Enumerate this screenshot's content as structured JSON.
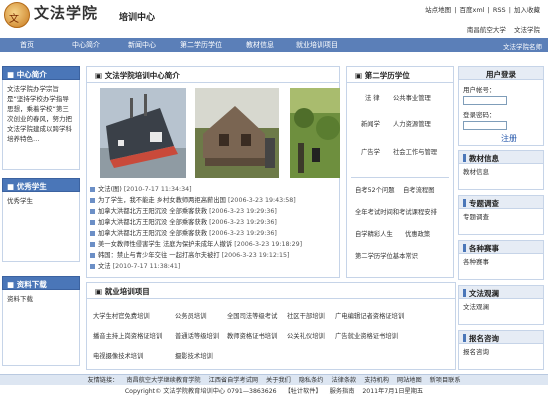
{
  "header": {
    "logo_glyph": "文",
    "title": "文法学院",
    "subtitle": "培训中心",
    "top_links": [
      "站点地图",
      "|",
      "百度xml",
      "|",
      "RSS",
      "|",
      "加入收藏"
    ],
    "university": [
      "南昌航空大学",
      "文法学院"
    ]
  },
  "nav": {
    "items": [
      "首页",
      "中心简介",
      "新闻中心",
      "第二学历学位",
      "教材信息",
      "就业培训项目"
    ],
    "right_text": "文法学院名师"
  },
  "left": {
    "intro_title": "中心简介",
    "intro_text": "文法学院办学宗旨是“坚持学校办学指导思想，乘着学校“第三次创业的春风，努力把文法学院建成以跨学科培养特色…",
    "students_title": "优秀学生",
    "students_item": "优秀学生",
    "download_title": "资料下载",
    "download_item": "资料下载"
  },
  "intro": {
    "title": "文法学院培训中心简介",
    "news": [
      {
        "text": "文法(图)",
        "date": "[2010-7-17 11:34:34]"
      },
      {
        "text": "为了学生，我不能走 乡村女教师两拒高薪出国",
        "date": "[2006-3-23 19:43:58]"
      },
      {
        "text": "加拿大洪都北方王阳沉没 全部乘客获救",
        "date": "[2006-3-23 19:29:36]"
      },
      {
        "text": "加拿大洪都北方王阳沉没 全部乘客获救",
        "date": "[2006-3-23 19:29:36]"
      },
      {
        "text": "加拿大洪都北方王阳沉没 全部乘客获救",
        "date": "[2006-3-23 19:29:36]"
      },
      {
        "text": "美一女教师性侵害学生 法庭为保护未成年人撤诉",
        "date": "[2006-3-23 19:18:29]"
      },
      {
        "text": "韩国：禁止与青少年交往 一起打高尔夫被打",
        "date": "[2006-3-23 19:12:15]"
      },
      {
        "text": "文法",
        "date": "[2010-7-17 11:38:41]"
      }
    ]
  },
  "degree": {
    "title": "第二学历学位",
    "rows": [
      [
        "法 律",
        "公共事业管理"
      ],
      [
        "新闻学",
        "人力资源管理"
      ],
      [
        "广告学",
        "社会工作与管理"
      ]
    ],
    "links": [
      [
        "自考52个问题",
        "自考流程图"
      ],
      [
        "全年考试时间和考试课程安排"
      ],
      [
        "自学精彩人生",
        "优惠政策"
      ],
      [
        "第二学历学位基本常识"
      ]
    ]
  },
  "training": {
    "title": "就业培训项目",
    "rows": [
      [
        "大学生村官免费培训",
        "公务员培训",
        "全国司法等级考试",
        "社区干部培训",
        "广电编辑记者资格证培训"
      ],
      [
        "播音主持上岗资格证培训",
        "普通话等级培训",
        "教师资格证书培训",
        "公关礼仪培训",
        "广告就业资格证书培训"
      ],
      [
        "电视摄像技术培训",
        "摄影技术培训"
      ]
    ]
  },
  "right": {
    "login_title": "用户登录",
    "account_label": "用户帐号：",
    "password_label": "登录密码：",
    "register": "注册",
    "materials_title": "教材信息",
    "materials_item": "教材信息",
    "survey_title": "专题调查",
    "survey_item": "专题调查",
    "events_title": "各种赛事",
    "events_item": "各种赛事",
    "literature_title": "文法观澜",
    "literature_item": "文法观澜",
    "consult_title": "报名咨询",
    "consult_item": "报名咨询"
  },
  "footer": {
    "links": [
      "友情链接：",
      "南昌航空大学继续教育学院",
      "江西省自学考试网",
      "关于我们",
      "隐私条约",
      "法律条款",
      "支持机构",
      "网站地图",
      "新项目联系"
    ],
    "copyright": [
      "Copyright© 文法学院教育培训中心 0791—3863626",
      "【牡计软件】",
      "服务指南",
      "2011年7月1日星期五"
    ]
  },
  "colors": {
    "nav": "#5b7fb8",
    "box_head": "#4a76b8",
    "link": "#2255aa"
  }
}
